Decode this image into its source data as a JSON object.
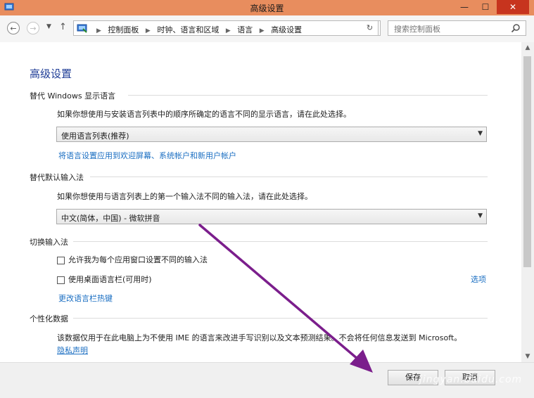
{
  "window": {
    "title": "高级设置",
    "minimize": "—",
    "maximize": "☐",
    "close": "✕"
  },
  "nav": {
    "back": "←",
    "forward": "→",
    "history_drop": "▼",
    "up": "↑",
    "breadcrumbs": [
      "控制面板",
      "时钟、语言和区域",
      "语言",
      "高级设置"
    ],
    "address_drop": "⌄",
    "refresh": "↻",
    "search_placeholder": "搜索控制面板"
  },
  "content": {
    "page_title": "高级设置",
    "display_lang": {
      "header": "替代 Windows 显示语言",
      "description": "如果你想使用与安装语言列表中的顺序所确定的语言不同的显示语言，请在此处选择。",
      "selected": "使用语言列表(推荐)",
      "apply_link": "将语言设置应用到欢迎屏幕、系统帐户和新用户帐户"
    },
    "input_method": {
      "header": "替代默认输入法",
      "description": "如果你想使用与语言列表上的第一个输入法不同的输入法，请在此处选择。",
      "selected": "中文(简体，中国) - 微软拼音"
    },
    "switching": {
      "header": "切换输入法",
      "checkbox1": "允许我为每个应用窗口设置不同的输入法",
      "checkbox2": "使用桌面语言栏(可用时)",
      "options_link": "选项",
      "hotkey_link": "更改语言栏热键"
    },
    "personalization": {
      "header": "个性化数据",
      "description": "该数据仅用于在此电脑上为不使用 IME 的语言来改进手写识别以及文本预测结果。不会将任何信息发送到 Microsoft。",
      "privacy_link": "隐私声明"
    }
  },
  "footer": {
    "save": "保存",
    "cancel": "取消"
  },
  "overlay": {
    "watermark": "jingyan.baidu.com",
    "arrow_color": "#7b1e8c"
  },
  "colors": {
    "titlebar": "#e88d5e",
    "close_button": "#c7341e",
    "link": "#1a6ec2",
    "page_title": "#1e3c96"
  }
}
